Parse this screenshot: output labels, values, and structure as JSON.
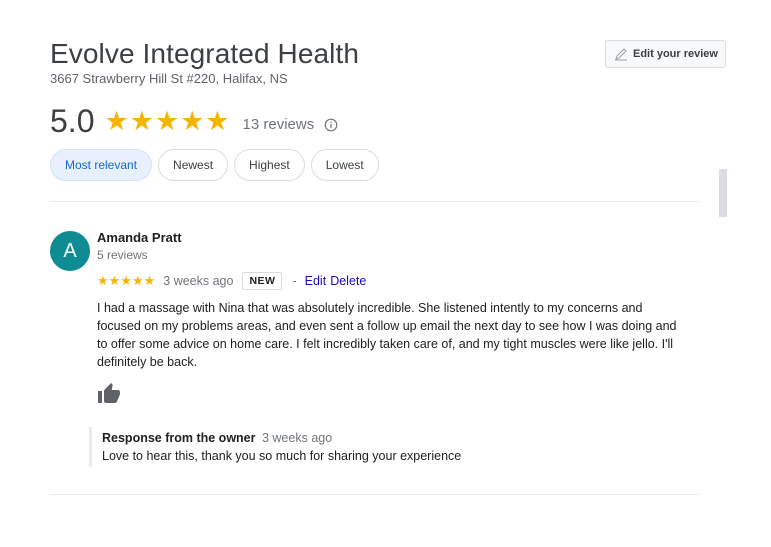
{
  "business": {
    "name": "Evolve Integrated Health",
    "address": "3667 Strawberry Hill St #220, Halifax, NS",
    "rating": "5.0",
    "stars": "★★★★★",
    "review_count": "13 reviews",
    "edit_review_label": "Edit your review"
  },
  "sort_chips": [
    {
      "label": "Most relevant",
      "selected": true
    },
    {
      "label": "Newest",
      "selected": false
    },
    {
      "label": "Highest",
      "selected": false
    },
    {
      "label": "Lowest",
      "selected": false
    }
  ],
  "review": {
    "avatar_letter": "A",
    "avatar_color": "#0f8b94",
    "author": "Amanda Pratt",
    "author_reviews": "5 reviews",
    "stars": "★★★★★",
    "rating": 5,
    "time": "3 weeks ago",
    "badge": "NEW",
    "separator": "-",
    "edit_label": "Edit",
    "delete_label": "Delete",
    "text": "I had a massage with Nina that was absolutely incredible. She listened intently to my concerns and focused on my problems areas, and even sent a follow up email the next day to see how I was doing and to offer some advice on home care. I felt incredibly taken care of, and my tight muscles were like jello. I'll definitely be back.",
    "like_icon": "thumbs-up-icon"
  },
  "owner_response": {
    "label": "Response from the owner",
    "time": "3 weeks ago",
    "text": "Love to hear this, thank you so much for sharing your experience"
  },
  "colors": {
    "star": "#f4b400",
    "link": "#1a0dab",
    "chip_selected_bg": "#e8f0fe",
    "chip_selected_text": "#1967d2"
  }
}
